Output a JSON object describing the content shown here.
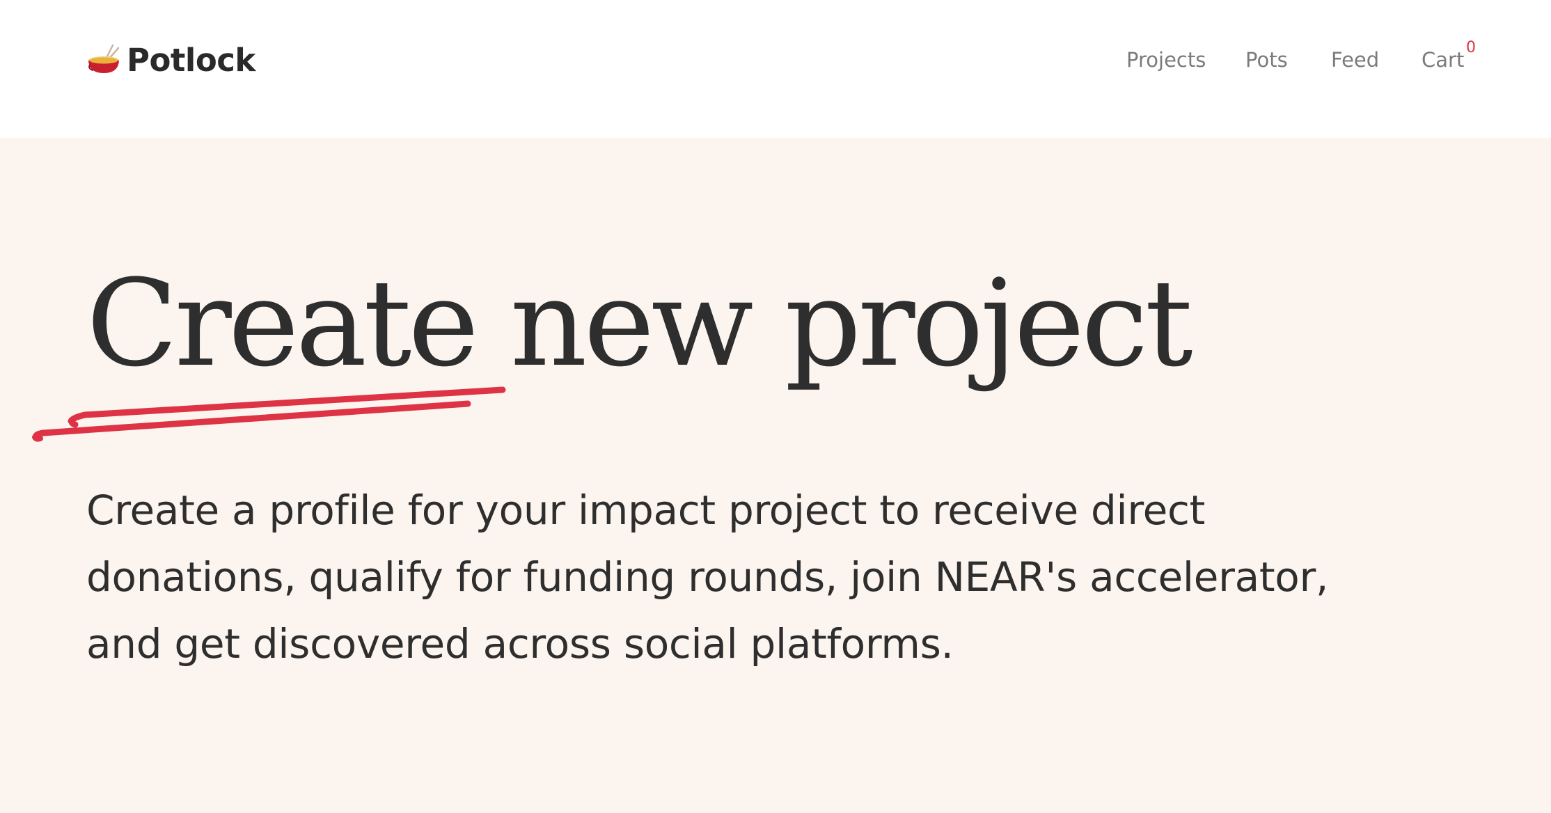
{
  "header": {
    "brand_name": "Potlock",
    "brand_icon": "fondue-pot-icon",
    "nav": [
      {
        "label": "Projects"
      },
      {
        "label": "Pots"
      },
      {
        "label": "Feed"
      },
      {
        "label": "Cart"
      }
    ],
    "cart_count": "0"
  },
  "hero": {
    "title": "Create new project",
    "description": "Create a profile for your impact project to receive direct donations, qualify for funding rounds, join NEAR's accelerator, and get discovered across social platforms."
  },
  "colors": {
    "accent": "#dd3345",
    "hero_background": "#fcf5ef",
    "text": "#2e2e2e",
    "nav_text": "#7b7b7b"
  }
}
